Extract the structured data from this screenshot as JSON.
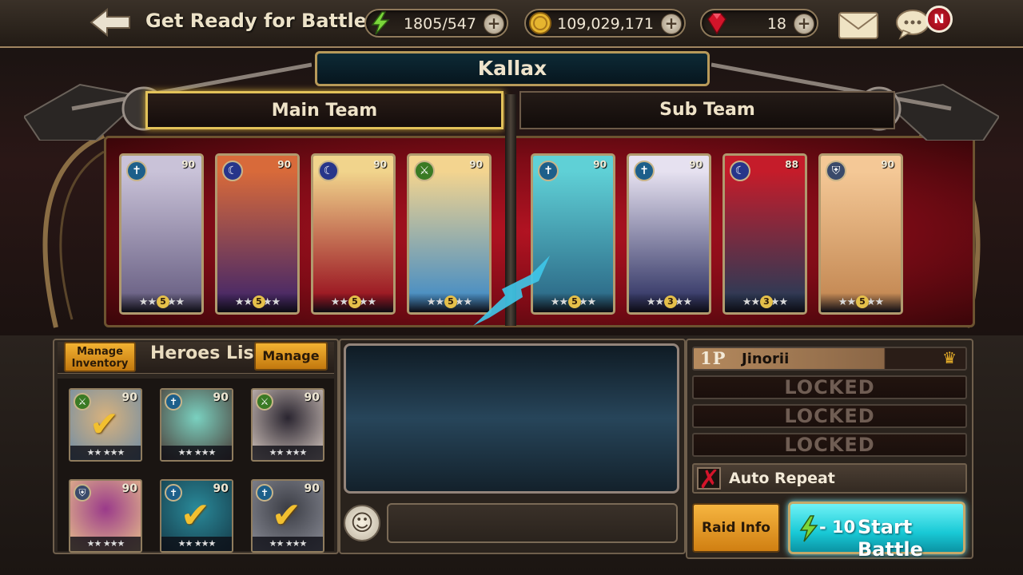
{
  "header": {
    "title": "Get Ready for Battle",
    "stamina": "1805/547",
    "gold": "109,029,171",
    "gems": "18",
    "plus": "+",
    "notification_badge": "N"
  },
  "boss": {
    "name": "Kallax"
  },
  "teams": {
    "main_label": "Main Team",
    "sub_label": "Sub Team",
    "main": [
      {
        "level": "90",
        "grade": "5",
        "class_icon": "cross-icon",
        "colors": [
          "#c9c2d8",
          "#6d6487"
        ]
      },
      {
        "level": "90",
        "grade": "5",
        "class_icon": "moon-icon",
        "colors": [
          "#d86a3a",
          "#4b2a66"
        ]
      },
      {
        "level": "90",
        "grade": "5",
        "class_icon": "moon-icon",
        "colors": [
          "#f1d48c",
          "#9b1722"
        ]
      },
      {
        "level": "90",
        "grade": "5",
        "class_icon": "sword-icon",
        "colors": [
          "#f3d48f",
          "#4a8fc3"
        ]
      }
    ],
    "sub": [
      {
        "level": "90",
        "grade": "5",
        "class_icon": "cross-icon",
        "colors": [
          "#5fd0d6",
          "#2e6d8a"
        ]
      },
      {
        "level": "90",
        "grade": "3",
        "class_icon": "cross-icon",
        "colors": [
          "#e6e1f0",
          "#3a3d6b"
        ]
      },
      {
        "level": "88",
        "grade": "3",
        "class_icon": "moon-icon",
        "colors": [
          "#c51c2a",
          "#2f3a55"
        ]
      },
      {
        "level": "90",
        "grade": "5",
        "class_icon": "shield-icon",
        "colors": [
          "#f4c896",
          "#c58a55"
        ]
      }
    ]
  },
  "heroes_list": {
    "title": "Heroes List",
    "manage_inventory": "Manage Inventory",
    "manage": "Manage",
    "heroes": [
      {
        "level": "90",
        "grade": "5",
        "class_icon": "sword-icon",
        "checked": true,
        "colors": [
          "#d9b27c",
          "#6d8ca7"
        ]
      },
      {
        "level": "90",
        "grade": "5",
        "class_icon": "cross-icon",
        "checked": false,
        "colors": [
          "#7ad1c0",
          "#4a3a35"
        ]
      },
      {
        "level": "90",
        "grade": "5",
        "class_icon": "sword-icon",
        "checked": false,
        "colors": [
          "#2a2530",
          "#d6c8c0"
        ]
      },
      {
        "level": "90",
        "grade": "5",
        "class_icon": "shield-icon",
        "checked": false,
        "colors": [
          "#9a3a8a",
          "#e8c08a"
        ]
      },
      {
        "level": "90",
        "grade": "5",
        "class_icon": "cross-icon",
        "checked": true,
        "colors": [
          "#2a8a9a",
          "#153a48"
        ]
      },
      {
        "level": "90",
        "grade": "5",
        "class_icon": "cross-icon",
        "checked": true,
        "colors": [
          "#3b3d45",
          "#8a8c96"
        ]
      }
    ],
    "check": "✔"
  },
  "party": {
    "p1_tag": "1P",
    "p1_name": "Jinorii",
    "locked": [
      "LOCKED",
      "LOCKED",
      "LOCKED"
    ],
    "crown": "♛"
  },
  "controls": {
    "auto_repeat": "Auto Repeat",
    "auto_mark": "✗",
    "raid_info": "Raid Info",
    "cost": "- 10",
    "start_battle": "Start Battle"
  },
  "emoji": "☺"
}
